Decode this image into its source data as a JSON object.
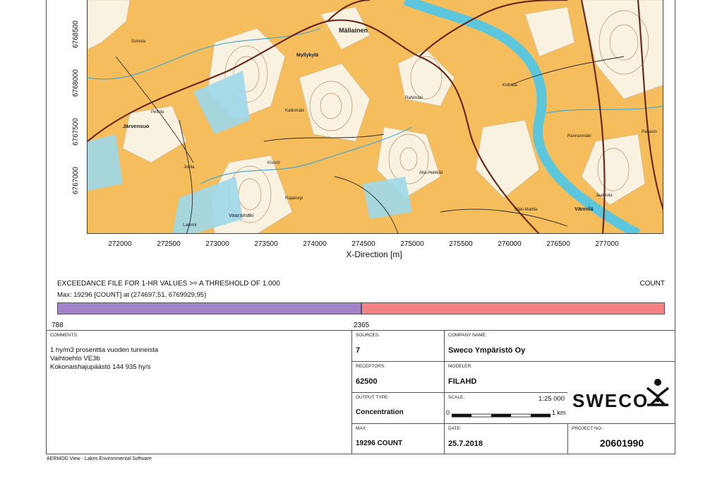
{
  "map": {
    "y_ticks": [
      "6768500",
      "6768000",
      "6767500",
      "6767000"
    ],
    "x_ticks": [
      "272000",
      "272500",
      "273000",
      "273500",
      "274000",
      "274500",
      "275000",
      "275500",
      "276000",
      "276500",
      "277000"
    ],
    "x_title": "X-Direction [m]",
    "places": {
      "mallainen": "Mällainen",
      "myllykyla": "Myllykylä",
      "jarvensuo": "Järvensuo",
      "vaaramaki": "Vaaramäki",
      "vannila": "Vännilä",
      "lammi": "Lammi",
      "kolmonen": "Kolmonen",
      "alta_heikkila": "Alta-Heikkilä",
      "rahamaki": "Rahimäki",
      "kalliomaki": "Kalliomäki",
      "pakasto": "Pakasto",
      "jaakkola": "Jaakkola",
      "raisiokivi": "Rajakorpi",
      "mari_mattila": "Mäki-Mattila",
      "peltola": "Peltola",
      "suinola": "Suinola",
      "kivisto": "Kivistö",
      "jokila": "Jokila",
      "kotirata": "Kotirata",
      "rannanmaki": "Rannanmäki"
    },
    "colors": {
      "land": "#f5bd5c",
      "field": "#faf2e0",
      "water": "#9fd8ea",
      "river": "#5cc6dd",
      "road": "#6b2a1f"
    }
  },
  "legend": {
    "exceedance": "EXCEEDANCE FILE FOR 1-HR VALUES >= A THRESHOLD OF 1.000",
    "count_label": "COUNT",
    "max_line": "Max:  19296  [COUNT]  at  (274697,51, 6769929,95)",
    "bins": [
      {
        "label": "788",
        "color": "#a283c9",
        "frac": 0.5
      },
      {
        "label": "2365",
        "color": "#f58282",
        "frac": 0.5
      }
    ]
  },
  "info": {
    "comments_label": "COMMENTS:",
    "comments": [
      "1 hy/m3 prosenttia vuoden tunneista",
      "Vaihtoehto VE3b",
      "Kokonaishajupäästö 144 935 hy/s"
    ],
    "sources_label": "SOURCES:",
    "sources": "7",
    "company_label": "COMPANY NAME:",
    "company": "Sweco Ympäristö Oy",
    "receptors_label": "RECEPTORS:",
    "receptors": "62500",
    "modeler_label": "MODELER:",
    "modeler": "FILAHD",
    "output_label": "OUTPUT TYPE:",
    "output": "Concentration",
    "scale_label": "SCALE:",
    "scale": "1:25 000",
    "scale_zero": "0",
    "scale_km": "1 km",
    "max_label": "MAX:",
    "max": "19296 COUNT",
    "date_label": "DATE:",
    "date": "25.7.2018",
    "project_label": "PROJECT NO.:",
    "project": "20601990",
    "logo": "SWECO"
  },
  "footer": "AERMOD View - Lakes Environmental Software"
}
